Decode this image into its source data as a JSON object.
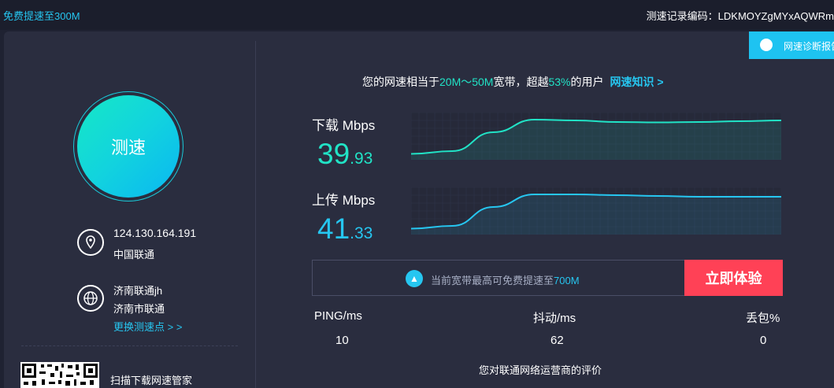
{
  "header": {
    "promo_link": "免费提速至300M",
    "record_label": "测速记录编码：",
    "record_code": "LDKMOYZgMYxAQWRm"
  },
  "diagnosis_button": {
    "label": "网速诊断报告"
  },
  "speed_button": {
    "label": "测速"
  },
  "connection": {
    "ip": "124.130.164.191",
    "isp": "中国联通",
    "node_name": "济南联通jh",
    "node_isp": "济南市联通",
    "change_node": "更换测速点 > >"
  },
  "qr_caption": "扫描下载网速管家",
  "summary": {
    "prefix": "您的网速相当于",
    "bandwidth": "20M～50M",
    "middle": "宽带，超越",
    "percent": "53%",
    "suffix": "的用户",
    "knowledge_link": "网速知识 >"
  },
  "download": {
    "label": "下载 Mbps",
    "integer": "39",
    "decimal": ".93",
    "color": "#21e3c6",
    "curve": [
      0.05,
      0.12,
      0.6,
      0.92,
      0.9,
      0.86,
      0.85,
      0.86,
      0.88,
      0.9
    ]
  },
  "upload": {
    "label": "上传 Mbps",
    "integer": "41",
    "decimal": ".33",
    "color": "#26c6f0",
    "curve": [
      0.05,
      0.12,
      0.6,
      0.92,
      0.92,
      0.9,
      0.88,
      0.86,
      0.86,
      0.86
    ]
  },
  "promo": {
    "prefix": "当前宽带最高可免费提速至",
    "value": "700M",
    "button": "立即体验"
  },
  "stats": {
    "ping_label": "PING/ms",
    "ping_value": "10",
    "jitter_label": "抖动/ms",
    "jitter_value": "62",
    "loss_label": "丢包%",
    "loss_value": "0"
  },
  "rating_text": "您对联通网络运营商的评价"
}
